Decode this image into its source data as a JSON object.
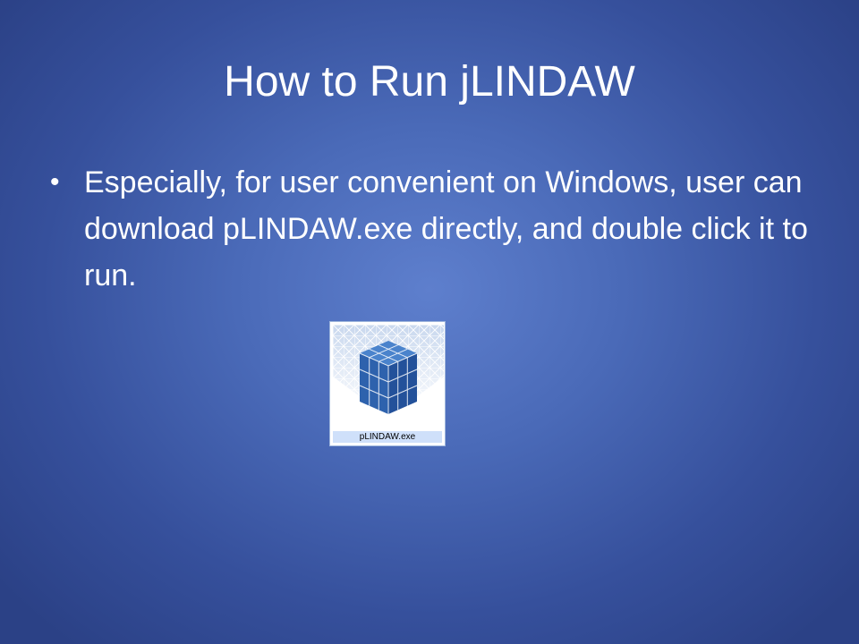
{
  "slide": {
    "title": "How to Run jLINDAW",
    "bullets": [
      "Especially, for user convenient on Windows, user can download pLINDAW.exe directly, and double click it to run."
    ],
    "bullet_glyph": "•"
  },
  "file_icon": {
    "label": "pLINDAW.exe",
    "icon": "cube-grid-icon",
    "colors": {
      "cube_front": "#2e5fa8",
      "cube_top": "#3f76c2",
      "cube_side": "#1f4a8d",
      "label_background": "#cfe0fa"
    }
  },
  "colors": {
    "background_center": "#5e7fcd",
    "background_edge": "#2b4186",
    "text": "#ffffff"
  }
}
